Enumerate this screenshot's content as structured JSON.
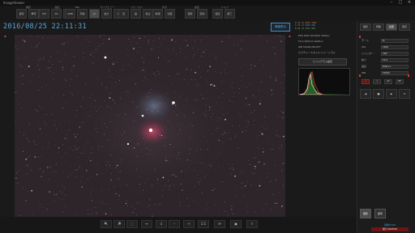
{
  "window": {
    "title": "ImageViewer",
    "controls": [
      "–",
      "□",
      "✕"
    ]
  },
  "toolbar": {
    "groups": [
      {
        "label": "撮影",
        "buttons": [
          "連写",
          "単写"
        ]
      },
      {
        "label": "露出",
        "buttons": [
          "ISO",
          "SS",
          "絞り"
        ]
      },
      {
        "label": "WB",
        "buttons": [
          "AWB",
          "手動"
        ]
      },
      {
        "label": "ライブビュー",
        "buttons": [
          "LV",
          "拡大",
          "AF"
        ]
      },
      {
        "label": "フォーカス",
        "buttons": [
          "近",
          "遠",
          "停止"
        ]
      },
      {
        "label": "表示",
        "buttons": [
          "情報",
          "比較"
        ]
      },
      {
        "label": "設定",
        "buttons": [
          "保存",
          "環境"
        ]
      },
      {
        "label": "ヘルプ",
        "buttons": [
          "接続",
          "終了"
        ]
      }
    ],
    "active_index": [
      3,
      0
    ]
  },
  "datetime": "2016/08/25 22:11:31",
  "context_button": "情報表示",
  "info": {
    "stats": [
      {
        "cls": "c1",
        "text": "R 10 12 6543  100%"
      },
      {
        "cls": "c2",
        "text": "G 10 11 5432   96%"
      },
      {
        "cls": "c3",
        "text": "B 09 10 4321   88%"
      }
    ],
    "lines": [
      "EOS 60D  ISO1600  300sec",
      "F4.0  300mm  RAW+L",
      "WB 5200K  NR:OFF",
      "ピクチャースタイル:ニュートラル"
    ],
    "button_label": "ヒストグラム設定"
  },
  "right_panel": {
    "tabs": [
      "撮影",
      "現像",
      "比較",
      "保存"
    ],
    "active_tab": 2,
    "rows": [
      {
        "label": "モード",
        "value": "M"
      },
      {
        "label": "ISO",
        "value": "1600"
      },
      {
        "label": "シャッター",
        "value": "300\""
      },
      {
        "label": "絞り",
        "value": "F4.0"
      },
      {
        "label": "画質",
        "value": "RAW+L"
      },
      {
        "label": "WB",
        "value": "5200K"
      }
    ],
    "small_buttons": [
      "－",
      "＋",
      "AF",
      "MF"
    ],
    "big_buttons": [
      "◀",
      "■",
      "▶",
      "⟲"
    ],
    "capture_buttons": [
      "撮影",
      "連写"
    ],
    "status_blue": "待機中 0/10",
    "status_red": "残り 00:05:00"
  },
  "bottom_bar": {
    "buttons": [
      "🔍",
      "🔎",
      "⬚",
      "↔",
      "↕",
      "–",
      "＋",
      "1:1",
      "⟳",
      "▣",
      "⇪"
    ]
  },
  "colors": {
    "accent_blue": "#5aa6d8",
    "alert_red": "#6b1515",
    "nebula_red": "#b0405a"
  }
}
